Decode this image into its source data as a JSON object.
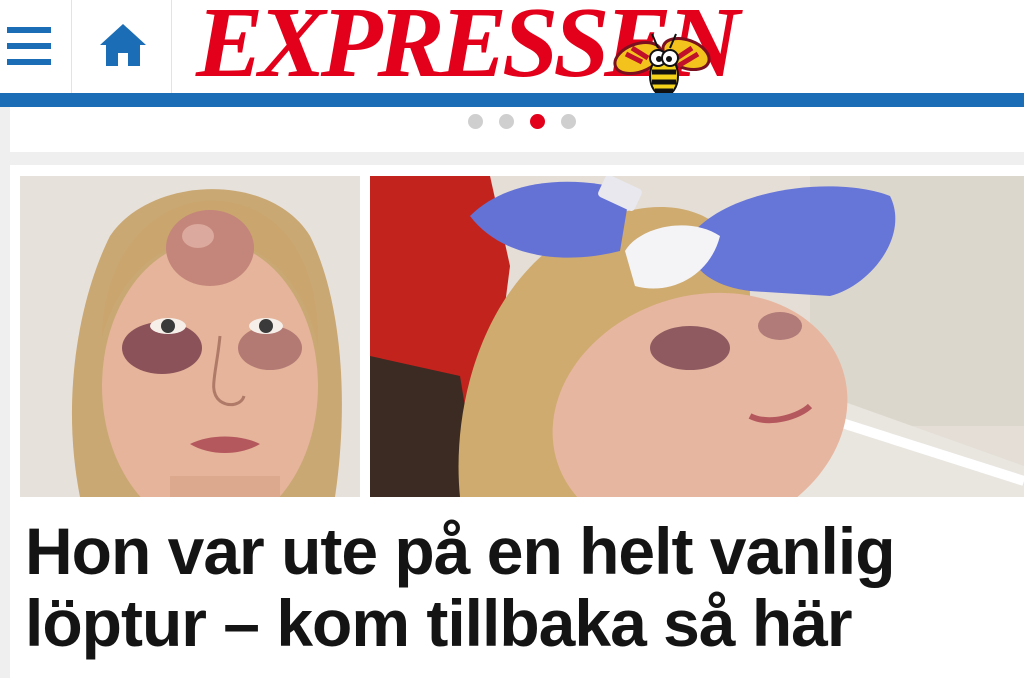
{
  "header": {
    "logo_text": "EXPRESSEN",
    "menu_icon": "hamburger-menu-icon",
    "home_icon": "home-icon",
    "mascot_icon": "wasp-mascot-icon"
  },
  "carousel": {
    "dot_count": 4,
    "active_index": 2
  },
  "article": {
    "headline": "Hon var ute på en helt vanlig löptur – kom tillbaka så här"
  },
  "colors": {
    "brand_red": "#e2001a",
    "brand_blue": "#1b6eb5"
  }
}
